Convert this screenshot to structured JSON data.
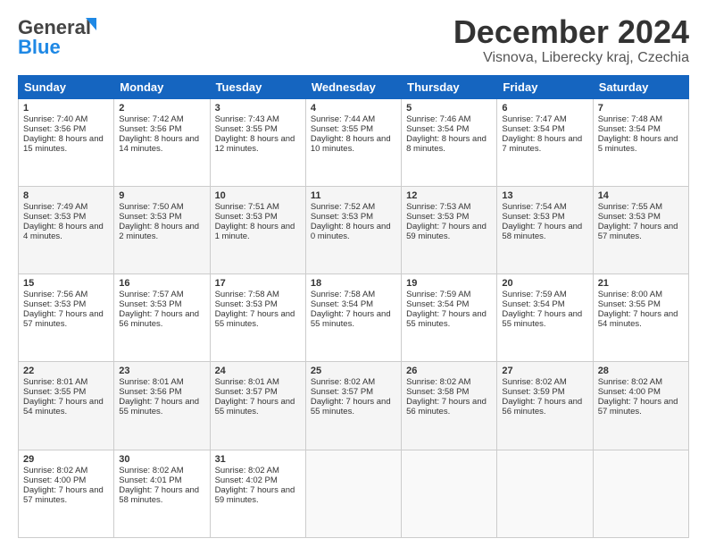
{
  "header": {
    "logo_general": "General",
    "logo_blue": "Blue",
    "month_title": "December 2024",
    "location": "Visnova, Liberecky kraj, Czechia"
  },
  "weekdays": [
    "Sunday",
    "Monday",
    "Tuesday",
    "Wednesday",
    "Thursday",
    "Friday",
    "Saturday"
  ],
  "weeks": [
    [
      {
        "day": "1",
        "sunrise": "Sunrise: 7:40 AM",
        "sunset": "Sunset: 3:56 PM",
        "daylight": "Daylight: 8 hours and 15 minutes."
      },
      {
        "day": "2",
        "sunrise": "Sunrise: 7:42 AM",
        "sunset": "Sunset: 3:56 PM",
        "daylight": "Daylight: 8 hours and 14 minutes."
      },
      {
        "day": "3",
        "sunrise": "Sunrise: 7:43 AM",
        "sunset": "Sunset: 3:55 PM",
        "daylight": "Daylight: 8 hours and 12 minutes."
      },
      {
        "day": "4",
        "sunrise": "Sunrise: 7:44 AM",
        "sunset": "Sunset: 3:55 PM",
        "daylight": "Daylight: 8 hours and 10 minutes."
      },
      {
        "day": "5",
        "sunrise": "Sunrise: 7:46 AM",
        "sunset": "Sunset: 3:54 PM",
        "daylight": "Daylight: 8 hours and 8 minutes."
      },
      {
        "day": "6",
        "sunrise": "Sunrise: 7:47 AM",
        "sunset": "Sunset: 3:54 PM",
        "daylight": "Daylight: 8 hours and 7 minutes."
      },
      {
        "day": "7",
        "sunrise": "Sunrise: 7:48 AM",
        "sunset": "Sunset: 3:54 PM",
        "daylight": "Daylight: 8 hours and 5 minutes."
      }
    ],
    [
      {
        "day": "8",
        "sunrise": "Sunrise: 7:49 AM",
        "sunset": "Sunset: 3:53 PM",
        "daylight": "Daylight: 8 hours and 4 minutes."
      },
      {
        "day": "9",
        "sunrise": "Sunrise: 7:50 AM",
        "sunset": "Sunset: 3:53 PM",
        "daylight": "Daylight: 8 hours and 2 minutes."
      },
      {
        "day": "10",
        "sunrise": "Sunrise: 7:51 AM",
        "sunset": "Sunset: 3:53 PM",
        "daylight": "Daylight: 8 hours and 1 minute."
      },
      {
        "day": "11",
        "sunrise": "Sunrise: 7:52 AM",
        "sunset": "Sunset: 3:53 PM",
        "daylight": "Daylight: 8 hours and 0 minutes."
      },
      {
        "day": "12",
        "sunrise": "Sunrise: 7:53 AM",
        "sunset": "Sunset: 3:53 PM",
        "daylight": "Daylight: 7 hours and 59 minutes."
      },
      {
        "day": "13",
        "sunrise": "Sunrise: 7:54 AM",
        "sunset": "Sunset: 3:53 PM",
        "daylight": "Daylight: 7 hours and 58 minutes."
      },
      {
        "day": "14",
        "sunrise": "Sunrise: 7:55 AM",
        "sunset": "Sunset: 3:53 PM",
        "daylight": "Daylight: 7 hours and 57 minutes."
      }
    ],
    [
      {
        "day": "15",
        "sunrise": "Sunrise: 7:56 AM",
        "sunset": "Sunset: 3:53 PM",
        "daylight": "Daylight: 7 hours and 57 minutes."
      },
      {
        "day": "16",
        "sunrise": "Sunrise: 7:57 AM",
        "sunset": "Sunset: 3:53 PM",
        "daylight": "Daylight: 7 hours and 56 minutes."
      },
      {
        "day": "17",
        "sunrise": "Sunrise: 7:58 AM",
        "sunset": "Sunset: 3:53 PM",
        "daylight": "Daylight: 7 hours and 55 minutes."
      },
      {
        "day": "18",
        "sunrise": "Sunrise: 7:58 AM",
        "sunset": "Sunset: 3:54 PM",
        "daylight": "Daylight: 7 hours and 55 minutes."
      },
      {
        "day": "19",
        "sunrise": "Sunrise: 7:59 AM",
        "sunset": "Sunset: 3:54 PM",
        "daylight": "Daylight: 7 hours and 55 minutes."
      },
      {
        "day": "20",
        "sunrise": "Sunrise: 7:59 AM",
        "sunset": "Sunset: 3:54 PM",
        "daylight": "Daylight: 7 hours and 55 minutes."
      },
      {
        "day": "21",
        "sunrise": "Sunrise: 8:00 AM",
        "sunset": "Sunset: 3:55 PM",
        "daylight": "Daylight: 7 hours and 54 minutes."
      }
    ],
    [
      {
        "day": "22",
        "sunrise": "Sunrise: 8:01 AM",
        "sunset": "Sunset: 3:55 PM",
        "daylight": "Daylight: 7 hours and 54 minutes."
      },
      {
        "day": "23",
        "sunrise": "Sunrise: 8:01 AM",
        "sunset": "Sunset: 3:56 PM",
        "daylight": "Daylight: 7 hours and 55 minutes."
      },
      {
        "day": "24",
        "sunrise": "Sunrise: 8:01 AM",
        "sunset": "Sunset: 3:57 PM",
        "daylight": "Daylight: 7 hours and 55 minutes."
      },
      {
        "day": "25",
        "sunrise": "Sunrise: 8:02 AM",
        "sunset": "Sunset: 3:57 PM",
        "daylight": "Daylight: 7 hours and 55 minutes."
      },
      {
        "day": "26",
        "sunrise": "Sunrise: 8:02 AM",
        "sunset": "Sunset: 3:58 PM",
        "daylight": "Daylight: 7 hours and 56 minutes."
      },
      {
        "day": "27",
        "sunrise": "Sunrise: 8:02 AM",
        "sunset": "Sunset: 3:59 PM",
        "daylight": "Daylight: 7 hours and 56 minutes."
      },
      {
        "day": "28",
        "sunrise": "Sunrise: 8:02 AM",
        "sunset": "Sunset: 4:00 PM",
        "daylight": "Daylight: 7 hours and 57 minutes."
      }
    ],
    [
      {
        "day": "29",
        "sunrise": "Sunrise: 8:02 AM",
        "sunset": "Sunset: 4:00 PM",
        "daylight": "Daylight: 7 hours and 57 minutes."
      },
      {
        "day": "30",
        "sunrise": "Sunrise: 8:02 AM",
        "sunset": "Sunset: 4:01 PM",
        "daylight": "Daylight: 7 hours and 58 minutes."
      },
      {
        "day": "31",
        "sunrise": "Sunrise: 8:02 AM",
        "sunset": "Sunset: 4:02 PM",
        "daylight": "Daylight: 7 hours and 59 minutes."
      },
      null,
      null,
      null,
      null
    ]
  ]
}
